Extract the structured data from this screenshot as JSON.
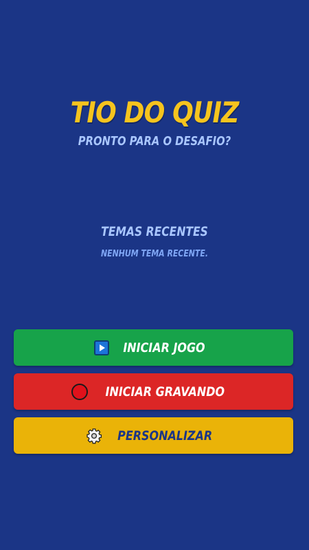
{
  "header": {
    "title": "TIO DO QUIZ",
    "subtitle": "PRONTO PARA O DESAFIO?"
  },
  "recent": {
    "title": "TEMAS RECENTES",
    "empty_text": "NENHUM TEMA RECENTE."
  },
  "buttons": {
    "start": {
      "label": "INICIAR JOGO",
      "icon": "play-icon"
    },
    "record": {
      "label": "INICIAR GRAVANDO",
      "icon": "record-icon"
    },
    "customize": {
      "label": "PERSONALIZAR",
      "icon": "gear-icon"
    }
  },
  "colors": {
    "background": "#1b3586",
    "title": "#f6c41e",
    "subtitle": "#a9c6ff",
    "start_button": "#17a34a",
    "record_button": "#dc2626",
    "customize_button": "#eab308"
  }
}
